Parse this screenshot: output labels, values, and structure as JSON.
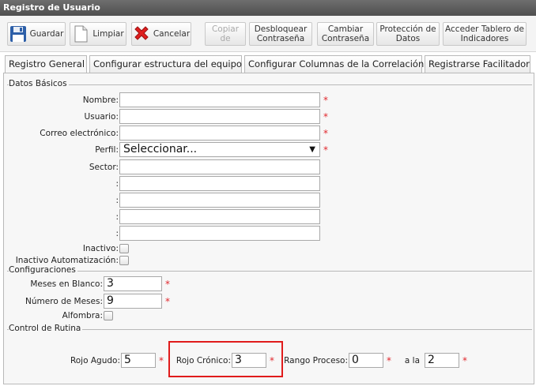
{
  "window": {
    "title": "Registro de Usuario"
  },
  "toolbar": {
    "save": "Guardar",
    "clear": "Limpiar",
    "cancel": "Cancelar",
    "copy_l1": "Copiar",
    "copy_l2": "de",
    "unlock_l1": "Desbloquear",
    "unlock_l2": "Contraseña",
    "change_l1": "Cambiar",
    "change_l2": "Contraseña",
    "protect_l1": "Protección de",
    "protect_l2": "Datos",
    "dashboard_l1": "Acceder Tablero de",
    "dashboard_l2": "Indicadores"
  },
  "tabs": [
    {
      "label": "Registro General"
    },
    {
      "label": "Configurar estructura del equipo"
    },
    {
      "label": "Configurar Columnas de la Correlación"
    },
    {
      "label": "Registrarse Facilitador"
    }
  ],
  "basic": {
    "legend": "Datos Básicos",
    "name_label": "Nombre:",
    "user_label": "Usuario:",
    "email_label": "Correo electrónico:",
    "profile_label": "Perfil:",
    "profile_value": "Seleccionar...",
    "sector_label": "Sector:",
    "extra1_label": ":",
    "extra2_label": ":",
    "extra3_label": ":",
    "extra4_label": ":",
    "inactive_label": "Inactivo:",
    "auto_inactive_label": "Inactivo Automatización:",
    "required": "*"
  },
  "config": {
    "legend": "Configuraciones",
    "blank_months_label": "Meses en Blanco:",
    "blank_months_value": "3",
    "months_label": "Número de Meses:",
    "months_value": "9",
    "carpet_label": "Alfombra:"
  },
  "routine": {
    "legend": "Control de Rutina",
    "acute_label": "Rojo Agudo:",
    "acute_value": "5",
    "chronic_label": "Rojo Crónico:",
    "chronic_value": "3",
    "process_label": "Rango Proceso:",
    "process_from": "0",
    "to_label": "a la",
    "process_to": "2"
  },
  "colors": {
    "accent_required": "#e0282e",
    "highlight": "#e01b1b"
  }
}
